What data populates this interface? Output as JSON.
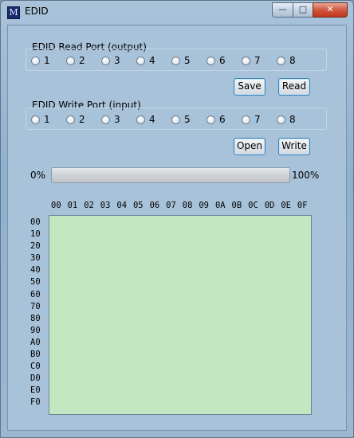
{
  "window": {
    "title": "EDID",
    "icon_glyph": "M",
    "controls": {
      "minimize": "—",
      "maximize": "□",
      "close": "✕"
    }
  },
  "read_port": {
    "label": "EDID Read Port (output)",
    "options": [
      "1",
      "2",
      "3",
      "4",
      "5",
      "6",
      "7",
      "8"
    ],
    "selected": null,
    "save_label": "Save",
    "read_label": "Read"
  },
  "write_port": {
    "label": "EDID Write Port (input)",
    "options": [
      "1",
      "2",
      "3",
      "4",
      "5",
      "6",
      "7",
      "8"
    ],
    "selected": null,
    "open_label": "Open",
    "write_label": "Write"
  },
  "progress": {
    "min_label": "0%",
    "max_label": "100%",
    "value": 0
  },
  "hex_table": {
    "columns": [
      "00",
      "01",
      "02",
      "03",
      "04",
      "05",
      "06",
      "07",
      "08",
      "09",
      "0A",
      "0B",
      "0C",
      "0D",
      "0E",
      "0F"
    ],
    "rows": [
      "00",
      "10",
      "20",
      "30",
      "40",
      "50",
      "60",
      "70",
      "80",
      "90",
      "A0",
      "B0",
      "C0",
      "D0",
      "E0",
      "F0"
    ]
  },
  "colors": {
    "grid_fill": "#c3e7c1",
    "window_frame": "#a9c3da",
    "button_border": "#3c7fb1"
  }
}
